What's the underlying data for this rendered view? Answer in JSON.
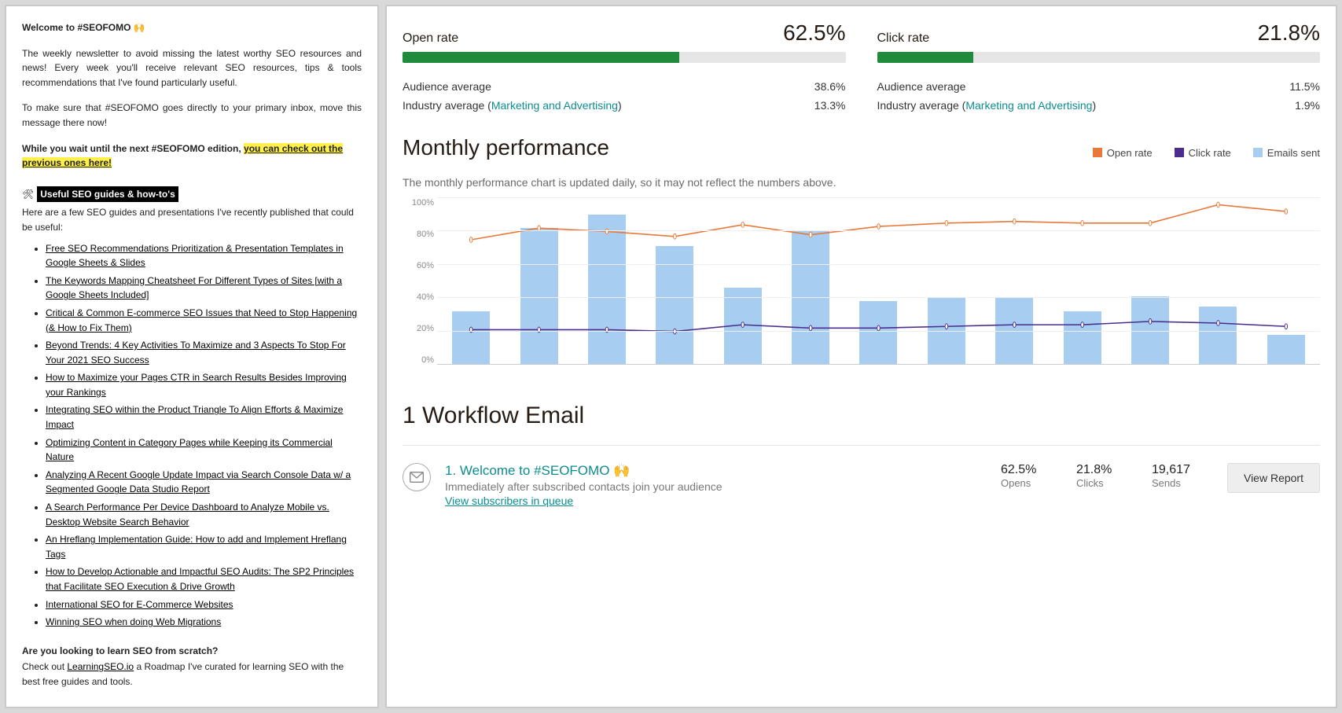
{
  "newsletter": {
    "title": "Welcome to #SEOFOMO 🙌",
    "intro": "The weekly newsletter to avoid missing the latest worthy SEO resources and news! Every week you'll receive relevant SEO resources, tips & tools recommendations that I've found particularly useful.",
    "inbox_note": "To make sure that #SEOFOMO goes directly to your primary inbox, move this message there now!",
    "wait_prefix": "While you wait until the next #SEOFOMO edition, ",
    "wait_link": "you can check out the previous ones here!",
    "section_icon": "🛠",
    "section_label": " Useful SEO guides & how-to's ",
    "section_intro": "Here are a few SEO guides and presentations I've recently published that could be useful:",
    "links": [
      "Free SEO Recommendations Prioritization & Presentation Templates in Google Sheets & Slides",
      "The Keywords Mapping Cheatsheet For Different Types of Sites [with a Google Sheets Included]",
      "Critical & Common E-commerce SEO Issues that Need to Stop Happening (& How to Fix Them)",
      "Beyond Trends: 4 Key Activities To Maximize and 3 Aspects To Stop For Your 2021 SEO Success",
      "How to Maximize your Pages CTR in Search Results Besides Improving your Rankings",
      "Integrating SEO within the Product Triangle To Align Efforts & Maximize Impact",
      "Optimizing Content in Category Pages while Keeping its Commercial Nature",
      "Analyzing A Recent Google Update Impact via Search Console Data w/ a Segmented Google Data Studio Report",
      "A Search Performance Per Device Dashboard to Analyze Mobile vs. Desktop Website Search Behavior",
      "An Hreflang Implementation Guide: How to add and Implement Hreflang Tags",
      "How to Develop Actionable and Impactful SEO Audits: The SP2 Principles that Facilitate SEO Execution & Drive Growth",
      "International SEO for E-Commerce Websites",
      "Winning SEO when doing Web Migrations"
    ],
    "learn_q": "Are you looking to learn SEO from scratch?",
    "learn_prefix": "Check out ",
    "learn_link": "LearningSEO.io",
    "learn_suffix": " a Roadmap I've curated for learning SEO with the best free guides and tools."
  },
  "metrics": {
    "open": {
      "label": "Open rate",
      "value": "62.5%",
      "fill_pct": 62.5,
      "aud_label": "Audience average",
      "aud_val": "38.6%",
      "ind_prefix": "Industry average (",
      "ind_link": "Marketing and Advertising",
      "ind_suffix": ")",
      "ind_val": "13.3%"
    },
    "click": {
      "label": "Click rate",
      "value": "21.8%",
      "fill_pct": 21.8,
      "aud_label": "Audience average",
      "aud_val": "11.5%",
      "ind_prefix": "Industry average (",
      "ind_link": "Marketing and Advertising",
      "ind_suffix": ")",
      "ind_val": "1.9%"
    }
  },
  "chart_title": "Monthly performance",
  "chart_sub": "The monthly performance chart is updated daily, so it may not reflect the numbers above.",
  "legend": {
    "open": "Open rate",
    "click": "Click rate",
    "sent": "Emails sent"
  },
  "colors": {
    "open": "#e8793a",
    "click": "#4a2d8f",
    "sent": "#a7cdf0",
    "bar": "#1f8b3b"
  },
  "chart_data": {
    "type": "bar+line",
    "ylim": [
      0,
      100
    ],
    "yticks": [
      "100%",
      "80%",
      "60%",
      "40%",
      "20%",
      "0%"
    ],
    "series": [
      {
        "name": "Emails sent",
        "kind": "bar",
        "values": [
          32,
          82,
          90,
          71,
          46,
          80,
          38,
          40,
          40,
          32,
          41,
          35,
          18
        ]
      },
      {
        "name": "Open rate",
        "kind": "line",
        "values": [
          75,
          82,
          80,
          77,
          84,
          78,
          83,
          85,
          86,
          85,
          85,
          96,
          92
        ]
      },
      {
        "name": "Click rate",
        "kind": "line",
        "values": [
          21,
          21,
          21,
          20,
          24,
          22,
          22,
          23,
          24,
          24,
          26,
          25,
          23
        ]
      }
    ]
  },
  "workflow": {
    "title": "1 Workflow Email",
    "item": {
      "name": "1. Welcome to #SEOFOMO 🙌",
      "desc": "Immediately after subscribed contacts join your audience",
      "queue_link": "View subscribers in queue",
      "opens_val": "62.5%",
      "opens_lab": "Opens",
      "clicks_val": "21.8%",
      "clicks_lab": "Clicks",
      "sends_val": "19,617",
      "sends_lab": "Sends",
      "button": "View Report"
    }
  }
}
